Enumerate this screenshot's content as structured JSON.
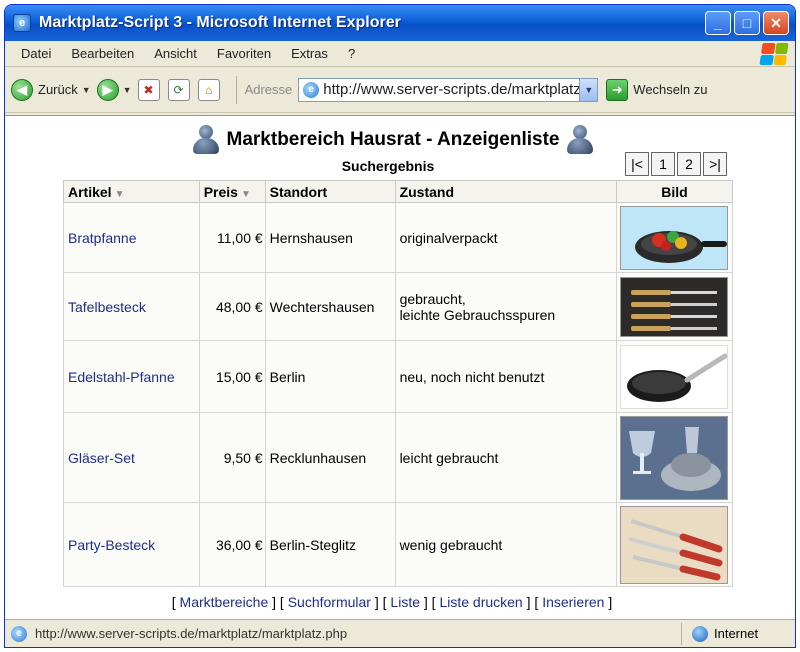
{
  "window": {
    "title": "Marktplatz-Script 3 - Microsoft Internet Explorer",
    "app_icon": "e"
  },
  "menu": [
    "Datei",
    "Bearbeiten",
    "Ansicht",
    "Favoriten",
    "Extras",
    "?"
  ],
  "toolbar": {
    "back_label": "Zurück",
    "address_label": "Adresse",
    "address_value": "http://www.server-scripts.de/marktplatz/marktplatz.php",
    "go_label": "Wechseln zu"
  },
  "page": {
    "title": "Marktbereich Hausrat - Anzeigenliste",
    "subtitle": "Suchergebnis",
    "pager": [
      "|<",
      "1",
      "2",
      ">|"
    ],
    "columns": [
      "Artikel",
      "Preis",
      "Standort",
      "Zustand",
      "Bild"
    ],
    "rows": [
      {
        "article": "Bratpfanne",
        "price": "11,00 €",
        "location": "Hernshausen",
        "condition": "originalverpackt",
        "condition2": "",
        "image": "pan-with-vegetables"
      },
      {
        "article": "Tafelbesteck",
        "price": "48,00 €",
        "location": "Wechtershausen",
        "condition": "gebraucht,",
        "condition2": "leichte Gebrauchsspuren",
        "image": "cutlery-set"
      },
      {
        "article": "Edelstahl-Pfanne",
        "price": "15,00 €",
        "location": "Berlin",
        "condition": "neu, noch nicht benutzt",
        "condition2": "",
        "image": "steel-pan"
      },
      {
        "article": "Gläser-Set",
        "price": "9,50 €",
        "location": "Recklunhausen",
        "condition": "leicht gebraucht",
        "condition2": "",
        "image": "glasses-set"
      },
      {
        "article": "Party-Besteck",
        "price": "36,00 €",
        "location": "Berlin-Steglitz",
        "condition": "wenig gebraucht",
        "condition2": "",
        "image": "party-cutlery"
      }
    ],
    "footer": {
      "marktbereiche": "Marktbereiche",
      "suchformular": "Suchformular",
      "liste": "Liste",
      "liste_drucken": "Liste drucken",
      "inserieren": "Inserieren"
    }
  },
  "status": {
    "url": "http://www.server-scripts.de/marktplatz/marktplatz.php",
    "zone": "Internet"
  },
  "colors": {
    "link": "#1f2e8c",
    "titlebar": "#0a5fd8",
    "chrome": "#ece9d8"
  }
}
